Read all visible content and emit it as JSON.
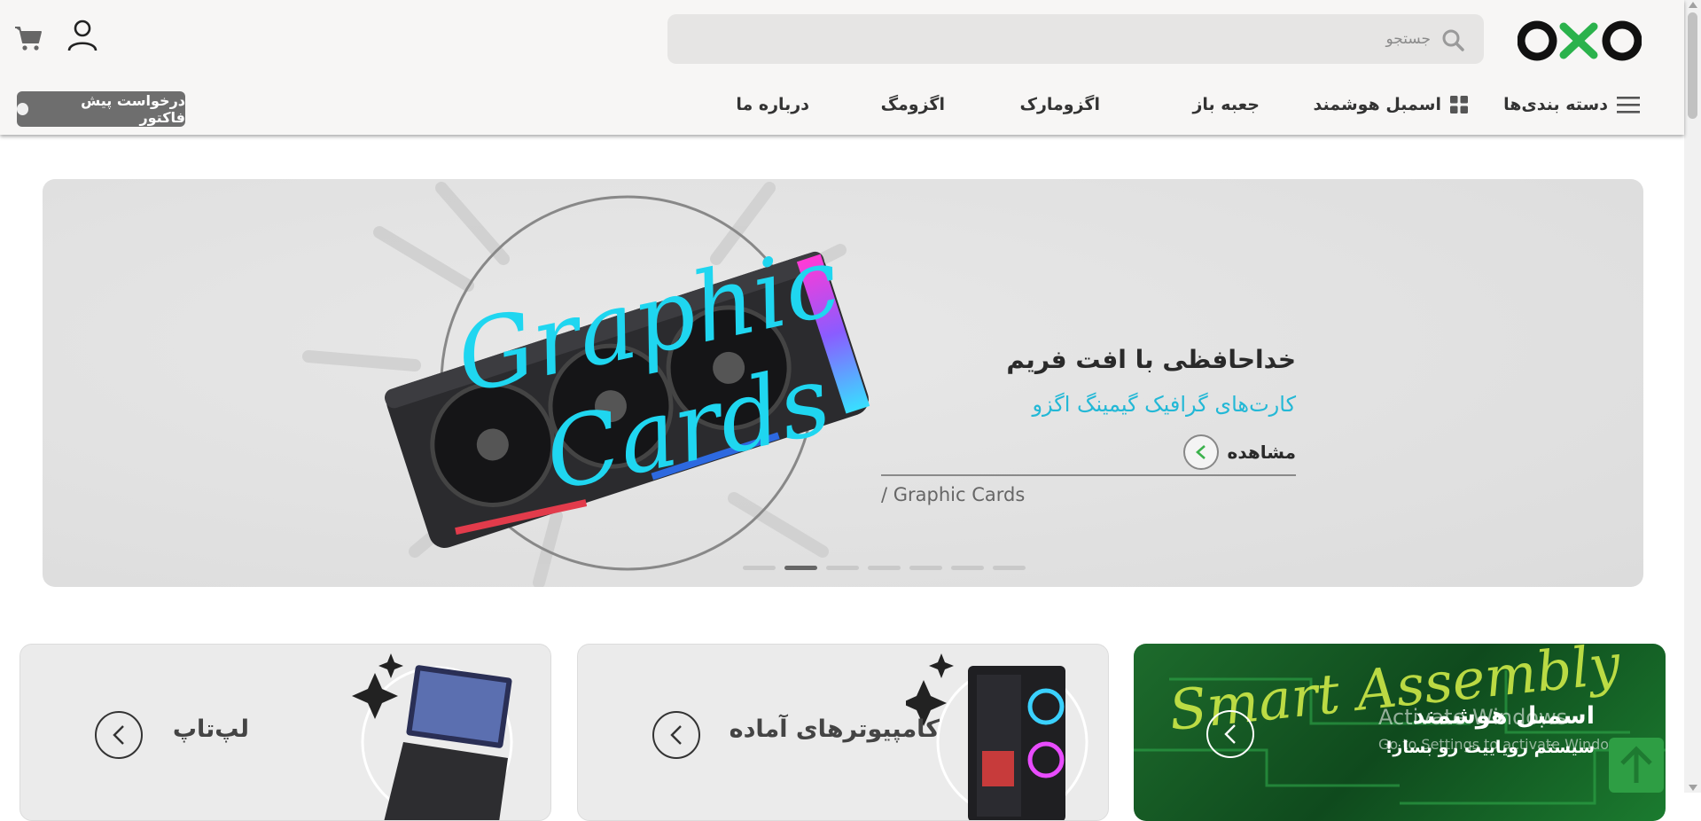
{
  "header": {
    "logo_alt": "OXO",
    "search": {
      "placeholder": "جستجو",
      "value": ""
    },
    "nav": [
      {
        "label": "دسته بندی‌ها",
        "icon": "hamburger-icon"
      },
      {
        "label": "اسمبل هوشمند",
        "icon": "grid-icon"
      },
      {
        "label": "جعبه باز"
      },
      {
        "label": "اگزومارک"
      },
      {
        "label": "اگزومگ"
      },
      {
        "label": "درباره ما"
      }
    ],
    "quote_button": "درخواست پیش فاکتور"
  },
  "hero": {
    "art_text_1": "Graphic",
    "art_text_2": "Cards",
    "title": "خداحافظی با افت فریم",
    "subtitle": "کارت‌های گرافیک گیمینگ اگزو",
    "view_label": "مشاهده",
    "breadcrumb": "/ Graphic Cards",
    "slides_count": 7,
    "active_slide": 1,
    "accent_color": "#23b8d6"
  },
  "cards": [
    {
      "label": "اسمبل هوشمند",
      "sublabel": "سیستم رویاییت رو بساز!",
      "art_text": "Smart Assembly"
    },
    {
      "label": "کامپیوترهای آماده"
    },
    {
      "label": "لپ‌تاپ"
    }
  ],
  "watermark": {
    "line1": "Activate Windows",
    "line2": "Go to Settings to activate Windows."
  },
  "colors": {
    "header_bg": "#f7f6f5",
    "quote_btn": "#6e6e6e",
    "green_card": "#1d6b2c",
    "to_top": "#2e9e44"
  }
}
